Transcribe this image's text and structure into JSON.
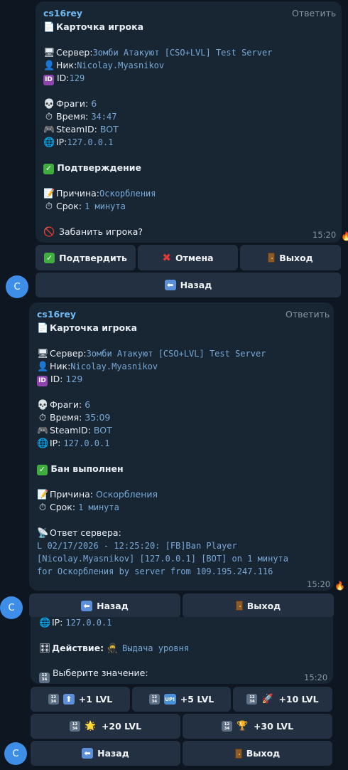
{
  "messages": [
    {
      "sender": "cs16rey",
      "reply_label": "Ответить",
      "card_title": "Карточка игрока",
      "server_label": "Сервер:",
      "server_value": "Зомби Атакуют [CSO+LVL] Test Server",
      "nick_label": "Ник:",
      "nick_value": "Nicolay.Myasnikov",
      "id_label": "ID:",
      "id_value": "129",
      "frags_label": "Фраги:",
      "frags_value": "6",
      "time_label": "Время:",
      "time_value": "34:47",
      "steam_label": "SteamID:",
      "steam_value": "BOT",
      "ip_label": "IP:",
      "ip_value": "127.0.0.1",
      "status": "Подтверждение",
      "reason_label": "Причина:",
      "reason_value": "Оскорбления",
      "term_label": "Срок:",
      "term_value": "1 минута",
      "question": "Забанить игрока?",
      "timestamp": "15:20",
      "reaction": "🔥",
      "buttons_row1": [
        "Подтвердить",
        "Отмена",
        "Выход"
      ],
      "button_back": "Назад"
    },
    {
      "sender": "cs16rey",
      "reply_label": "Ответить",
      "card_title": "Карточка игрока",
      "server_label": "Сервер:",
      "server_value": "Зомби Атакуют [CSO+LVL] Test Server",
      "nick_label": "Ник:",
      "nick_value": "Nicolay.Myasnikov",
      "id_label": "ID:",
      "id_value": "129",
      "frags_label": "Фраги:",
      "frags_value": "6",
      "time_label": "Время:",
      "time_value": "35:09",
      "steam_label": "SteamID:",
      "steam_value": "BOT",
      "ip_label": "IP:",
      "ip_value": "127.0.0.1",
      "status": "Бан выполнен",
      "reason_label": "Причина:",
      "reason_value": "Оскорбления",
      "term_label": "Срок:",
      "term_value": "1 минута",
      "server_response_label": "Ответ сервера:",
      "server_response_lines": [
        "L 02/17/2026 - 12:25:20: [FB]Ban Player",
        "[Nicolay.Myasnikov] [127.0.0.1] [BOT] on 1 минута",
        "for Оскорбления by server from 109.195.247.116"
      ],
      "timestamp": "15:20",
      "reaction": "🔥",
      "button_back": "Назад",
      "button_exit": "Выход"
    },
    {
      "ip_label": "IP:",
      "ip_value": "127.0.0.1",
      "action_label": "Действие:",
      "action_value": "Выдача уровня",
      "prompt": "Выберите значение:",
      "timestamp": "15:20",
      "level_buttons": [
        "+1 LVL",
        "+5 LVL",
        "+10 LVL",
        "+20 LVL",
        "+30 LVL"
      ],
      "button_back": "Назад",
      "button_exit": "Выход"
    }
  ],
  "avatar_letter": "C",
  "colors": {
    "background": "#0e1621",
    "bubble": "#182533",
    "button": "#223041",
    "link": "#78a9d6",
    "sender": "#71baf2",
    "avatar": "#3e8ee8"
  }
}
